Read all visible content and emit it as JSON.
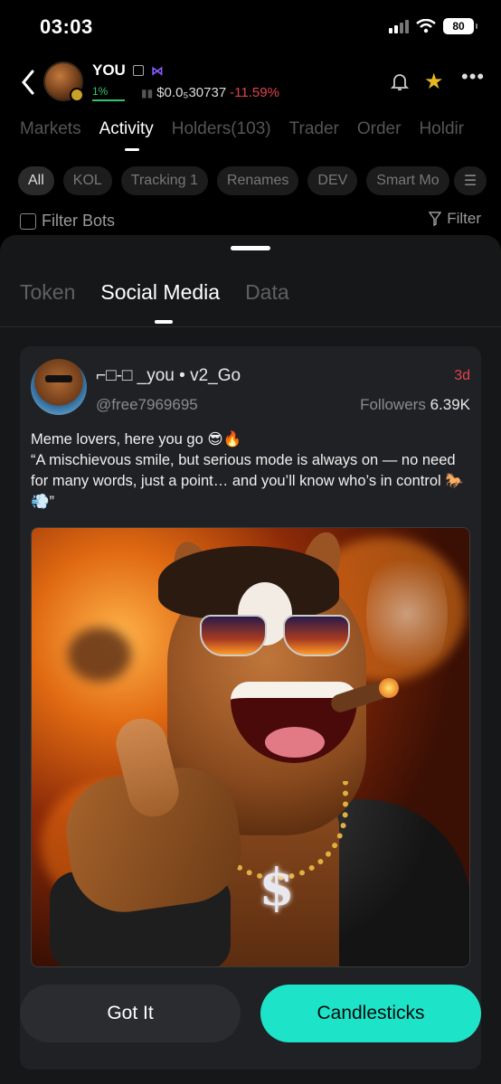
{
  "status_bar": {
    "time": "03:03",
    "battery": "80"
  },
  "token": {
    "name": "YOU",
    "pct_label": "1%",
    "price": "$0.0₅30737",
    "change": "-11.59%"
  },
  "main_tabs": [
    "Markets",
    "Activity",
    "Holders(103)",
    "Trader",
    "Order",
    "Holdir"
  ],
  "chips": [
    "All",
    "KOL",
    "Tracking 1",
    "Renames",
    "DEV",
    "Smart Mo"
  ],
  "filter_bots_label": "Filter Bots",
  "filter_label": "Filter",
  "sheet_tabs": [
    "Token",
    "Social Media",
    "Data"
  ],
  "post": {
    "display_name": "⌐□-□ _you • v2_Go",
    "handle": "@free7969695",
    "age": "3d",
    "followers_label": "Followers",
    "followers_count": "6.39K",
    "text_line1": "Meme lovers, here you go 😎🔥",
    "text_line2": "“A mischievous smile, but serious mode is always on — no need for many words, just a point… and you’ll know who’s in control 🐎💨”"
  },
  "buttons": {
    "got_it": "Got It",
    "candlesticks": "Candlesticks"
  },
  "colors": {
    "accent": "#1de3c9",
    "negative": "#e0434e",
    "positive": "#2fc56b",
    "star": "#e8b820"
  }
}
